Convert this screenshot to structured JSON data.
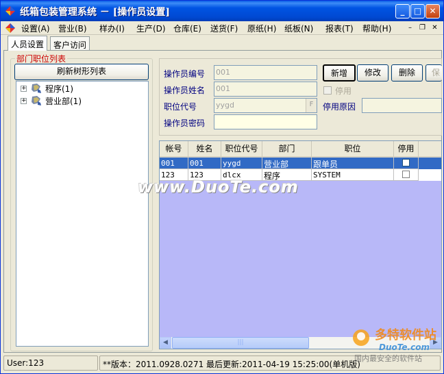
{
  "window": {
    "title": "纸箱包装管理系统 － [操作员设置]"
  },
  "menu": {
    "items": [
      "设置(A)",
      "营业(B)",
      "样办(I)",
      "生产(D)",
      "仓库(E)",
      "送货(F)",
      "原纸(H)",
      "纸板(N)",
      "报表(T)",
      "帮助(H)"
    ]
  },
  "tabs": [
    "人员设置",
    "客户访问"
  ],
  "left_group": {
    "legend": "部门职位列表",
    "refresh_button": "刷新树形列表",
    "tree": [
      {
        "label": "程序(1)"
      },
      {
        "label": "营业部(1)"
      }
    ]
  },
  "form": {
    "operator_id_label": "操作员编号",
    "operator_id_value": "001",
    "operator_name_label": "操作员姓名",
    "operator_name_value": "001",
    "position_code_label": "职位代号",
    "position_code_value": "yygd",
    "position_code_btn": "F",
    "password_label": "操作员密码",
    "password_value": "",
    "disabled_label": "停用",
    "disable_reason_label": "停用原因",
    "disable_reason_value": ""
  },
  "buttons": {
    "add": "新增",
    "edit": "修改",
    "delete": "删除",
    "save": "保"
  },
  "grid": {
    "columns": [
      "帐号",
      "姓名",
      "职位代号",
      "部门",
      "职位",
      "停用"
    ],
    "rows": [
      {
        "account": "001",
        "name": "001",
        "code": "yygd",
        "dept": "营业部",
        "position": "跟单员",
        "disabled": false,
        "selected": true
      },
      {
        "account": "123",
        "name": "123",
        "code": "dlcx",
        "dept": "程序",
        "position": "SYSTEM",
        "disabled": false,
        "selected": false
      }
    ],
    "scroll_thumb_glyph": "|||"
  },
  "status": {
    "user": "User:123",
    "version": "**版本：2011.0928.0271  最后更新:2011-04-19 15:25:00(单机版)"
  },
  "watermark": {
    "text": "www.DuoTe.com",
    "logo_title": "多特软件站",
    "logo_url": "DuoTe.com",
    "logo_tagline": "国内最安全的软件站"
  },
  "colors": {
    "title_bar": "#0054e3",
    "selected_row": "#316ac5",
    "grid_background": "#b8b8f8",
    "field_label": "#000080",
    "legend": "#cc0000"
  }
}
